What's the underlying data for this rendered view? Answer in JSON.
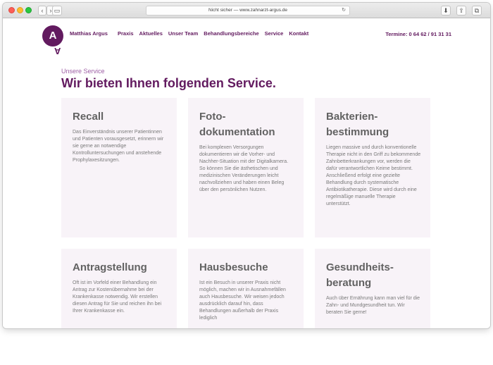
{
  "browser": {
    "url": "Nicht sicher — www.zahnarzt-argus.de"
  },
  "header": {
    "logo_letter": "A",
    "brand": "Matthias Argus",
    "nav": [
      "Praxis",
      "Aktuelles",
      "Unser Team",
      "Behandlungsbereiche",
      "Service",
      "Kontakt"
    ],
    "phone": "Termine: 0 64 62 / 91 31 31"
  },
  "intro": {
    "eyebrow": "Unsere Service",
    "headline": "Wir bieten Ihnen folgenden Service."
  },
  "cards": [
    {
      "title_lines": [
        "Recall"
      ],
      "text": "Das Einverständnis unserer Patientinnen und Patienten vorausgesetzt, erinnern wir sie gerne an notwendige Kontrolluntersuchungen und anstehende Prophylaxesitzungen."
    },
    {
      "title_lines": [
        "Foto-",
        "dokumentation"
      ],
      "text": "Bei komplexen Versorgungen dokumentieren wir die Vorher- und Nachher-Situation mit der Digitalkamera. So können Sie die ästhetischen und medizinischen Veränderungen leicht nachvollziehen und haben einen Beleg über den persönlichen Nutzen."
    },
    {
      "title_lines": [
        "Bakterien-",
        "bestimmung"
      ],
      "text": "Liegen massive und durch konventionelle Therapie nicht in den Griff zu bekommende Zahnbetterkrankungen vor, werden die dafür verantwortlichen Keime bestimmt. Anschließend erfolgt eine gezielte Behandlung durch systematische Antibiotikatherapie. Diese wird durch eine regelmäßige manuelle Therapie unterstützt."
    },
    {
      "title_lines": [
        "Antragstellung"
      ],
      "text": "Oft ist im Vorfeld einer Behandlung ein Antrag zur Kostenübernahme bei der Krankenkasse notwendig. Wir erstellen diesen Antrag für Sie und reichen ihn bei Ihrer Krankenkasse ein."
    },
    {
      "title_lines": [
        "Hausbesuche"
      ],
      "text": "Ist ein Besuch in unserer Praxis nicht möglich, machen wir in Ausnahmefällen auch Hausbesuche. Wir weisen jedoch ausdrücklich darauf hin, dass Behandlungen außerhalb der Praxis lediglich"
    },
    {
      "title_lines": [
        "Gesundheits-",
        "beratung"
      ],
      "text": "Auch über Ernährung kann man viel für die Zahn- und Mundgesundheit tun. Wir beraten Sie gerne!"
    }
  ]
}
